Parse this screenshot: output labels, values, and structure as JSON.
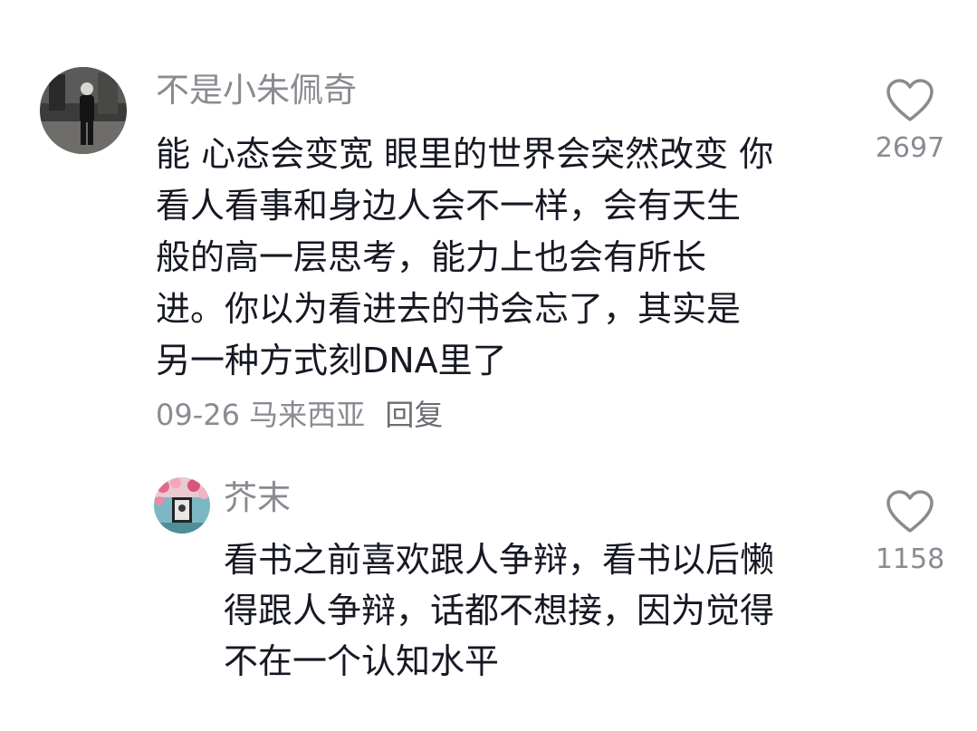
{
  "comments": [
    {
      "username": "不是小朱佩奇",
      "avatar_icon": "avatar-person-street-photo",
      "text_lines": [
        "能 心态会变宽 眼里的世界会突然改变 你",
        "看人看事和身边人会不一样，会有天生",
        "般的高一层思考，能力上也会有所长",
        "进。你以为看进去的书会忘了，其实是",
        "另一种方式刻DNA里了"
      ],
      "date": "09-26",
      "location": "马来西亚",
      "reply_label": "回复",
      "like_icon": "heart-outline-icon",
      "like_count": "2697"
    },
    {
      "username": "芥末",
      "avatar_icon": "avatar-flower-window-photo",
      "text_lines": [
        "看书之前喜欢跟人争辩，看书以后懒",
        "得跟人争辩，话都不想接，因为觉得",
        "不在一个认知水平"
      ],
      "like_icon": "heart-outline-icon",
      "like_count": "1158"
    }
  ],
  "colors": {
    "text_primary": "#161823",
    "text_secondary": "#8a8b91",
    "heart_stroke": "#8a8b91",
    "background": "#ffffff"
  }
}
